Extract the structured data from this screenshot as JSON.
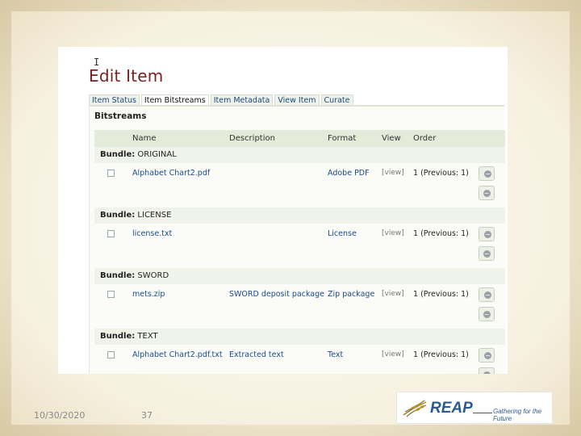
{
  "page": {
    "title": "Edit Item",
    "cursor_glyph": "I"
  },
  "tabs": [
    {
      "label": "Item Status",
      "active": false
    },
    {
      "label": "Item Bitstreams",
      "active": true
    },
    {
      "label": "Item Metadata",
      "active": false
    },
    {
      "label": "View Item",
      "active": false
    },
    {
      "label": "Curate",
      "active": false
    }
  ],
  "bitstreams": {
    "section_title": "Bitstreams",
    "columns": {
      "name": "Name",
      "description": "Description",
      "format": "Format",
      "view": "View",
      "order": "Order"
    },
    "bundle_prefix": "Bundle:",
    "bundles": [
      {
        "name": "ORIGINAL",
        "file": "Alphabet Chart2.pdf",
        "description": "",
        "format": "Adobe PDF",
        "view": "[view]",
        "order": "1 (Previous: 1)"
      },
      {
        "name": "LICENSE",
        "file": "license.txt",
        "description": "",
        "format": "License",
        "view": "[view]",
        "order": "1 (Previous: 1)"
      },
      {
        "name": "SWORD",
        "file": "mets.zip",
        "description": "SWORD deposit package",
        "format": "Zip package",
        "view": "[view]",
        "order": "1 (Previous: 1)"
      },
      {
        "name": "TEXT",
        "file": "Alphabet Chart2.pdf.txt",
        "description": "Extracted text",
        "format": "Text",
        "view": "[view]",
        "order": "1 (Previous: 1)"
      }
    ]
  },
  "footer": {
    "date": "10/30/2020",
    "slide_number": "37"
  },
  "logo": {
    "brand": "REAP",
    "tagline": "Gathering for the Future"
  },
  "colors": {
    "title": "#7a1f1f",
    "link": "#1a4a8a",
    "header_bg": "#e4ebd9",
    "logo_blue": "#2b5a92"
  }
}
